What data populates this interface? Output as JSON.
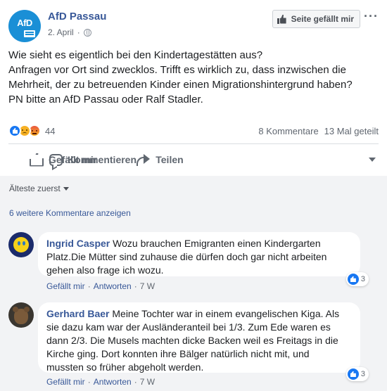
{
  "page": {
    "name": "AfD Passau",
    "logo_text": "AfD",
    "date": "2. April",
    "separator": "·",
    "like_page_label": "Seite gefällt mir",
    "more_label": "···"
  },
  "post": {
    "lines": [
      "Wie sieht es eigentlich bei den Kindertagestätten aus?",
      "Anfragen vor Ort sind zwecklos. Trifft es wirklich zu, dass inzwischen die",
      "Mehrheit, der zu betreuenden Kinder einen Migrationshintergrund haben?",
      "PN bitte an AfD Passau oder Ralf Stadler."
    ]
  },
  "stats": {
    "reaction_count": "44",
    "comments": "8 Kommentare",
    "shares": "13 Mal geteilt"
  },
  "actions": {
    "like": "Gefällt mir",
    "comment": "Kommentieren",
    "share": "Teilen"
  },
  "comments_section": {
    "sort_label": "Älteste zuerst",
    "more_comments": "6 weitere Kommentare anzeigen",
    "items": [
      {
        "author": "Ingrid Casper",
        "lines": [
          "Wozu brauchen Emigranten einen Kindergarten",
          "Platz.Die Mütter sind zuhause die dürfen doch gar nicht arbeiten",
          "gehen also frage ich wozu."
        ],
        "reaction_count": "3",
        "like": "Gefällt mir",
        "reply": "Antworten",
        "time": "7 W"
      },
      {
        "author": "Gerhard Baer",
        "lines": [
          "Meine Tochter war in einem evangelischen Kiga. Als",
          "sie dazu kam war der Ausländeranteil bei 1/3. Zum Ede waren es",
          "dann 2/3. Die Musels machten dicke Backen weil es Freitags in die",
          "Kirche ging. Dort konnten ihre Bälger natürlich nicht mit, und",
          "mussten so früher abgeholt werden."
        ],
        "reaction_count": "3",
        "like": "Gefällt mir",
        "reply": "Antworten",
        "time": "7 W"
      }
    ]
  },
  "colors": {
    "link": "#385898",
    "facebook_blue": "#1877f2",
    "muted": "#606770",
    "comment_bg": "#f2f3f5"
  }
}
